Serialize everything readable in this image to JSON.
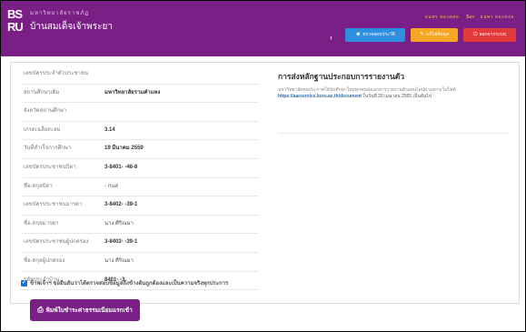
{
  "header": {
    "logo_mark_top": "BS",
    "logo_mark_bottom": "RU",
    "logo_line1": "มหาวิทยาลัยราชภัฏ",
    "logo_line2": "บ้านสมเด็จเจ้าพระยา",
    "user_name": "ธนพร ทองหล่อ",
    "user_role": "Ser",
    "user_id": "ธนพร ทองหล่อ",
    "buttons": {
      "profile": "ตรวจสอบประวัติ",
      "password": "แก้ไขข้อมูล",
      "logout": "ออกจากระบบ"
    }
  },
  "info_rows": [
    {
      "label": "เลขบัตรประจำตัวประชาชน",
      "value": ""
    },
    {
      "label": "สถานศึกษาเดิม",
      "value": "มหาวิทยาลัยรามคำแหง"
    },
    {
      "label": "จังหวัดสถานศึกษา",
      "value": ""
    },
    {
      "label": "เกรดเฉลี่ยสะสม",
      "value": "3.14"
    },
    {
      "label": "วันที่สำเร็จการศึกษา",
      "value": "19 มีนาคม 2559"
    },
    {
      "label": "เลขบัตรประชาชนบิดา",
      "value": "3-8401-      -46-8"
    },
    {
      "label": "ชื่อ-สกุลบิดา",
      "value": "- กนส"
    },
    {
      "label": "เลขบัตรประชาชนมารดา",
      "value": "3-8402-      -39-1"
    },
    {
      "label": "ชื่อ-สกุลมารดา",
      "value": "นาง ศิริณมา"
    },
    {
      "label": "เลขบัตรประชาชนผู้ปกครอง",
      "value": "3-8402-      -39-1"
    },
    {
      "label": "ชื่อ-สกุลผู้ปกครอง",
      "value": "นาง ศิริณมา"
    },
    {
      "label": "รหัสประจำบ้าน",
      "value": "8401-         -3"
    }
  ],
  "side": {
    "title": "การส่งหลักฐานประกอบการรายงานตัว",
    "body_text": "มหาวิทยาลัยขอประกาศให้นักศึกษาใหม่ทุกคนส่งเอกสารรายงานตัวออนไลน์ผ่านทางเว็บไซต์",
    "link": "https://aarservice.bsru.ac.th/document",
    "deadline": "ในวันที่ 20 เมษายน 2565 เป็นต้นไป"
  },
  "confirm": {
    "checked": true,
    "text": "ข้าพเจ้าฯ ขอยืนยันว่าได้ตรวจสอบข้อมูลถึงข้างต้นถูกต้องและเป็นความจริงทุกประการ"
  },
  "print_button": {
    "label": "พิมพ์ใบชำระค่าธรรมเนียมแรกเข้า"
  },
  "colors": {
    "header_bg": "#7a1f86",
    "profile_btn": "#2e8fe0",
    "password_btn": "#f5a623",
    "logout_btn": "#e33b3b",
    "checkbox": "#1e6be0"
  }
}
